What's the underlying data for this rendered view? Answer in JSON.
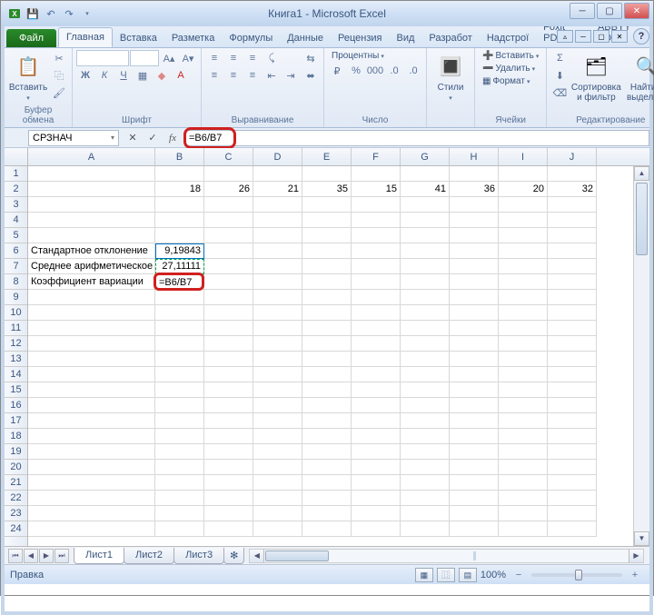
{
  "window": {
    "title": "Книга1 - Microsoft Excel"
  },
  "qat": {
    "save": "save-icon",
    "undo": "undo-icon",
    "redo": "redo-icon"
  },
  "tabs": {
    "file": "Файл",
    "items": [
      "Главная",
      "Вставка",
      "Разметка",
      "Формулы",
      "Данные",
      "Рецензия",
      "Вид",
      "Разработ",
      "Надстрої",
      "Foxit PDF",
      "ABBYY PD"
    ],
    "active_index": 0
  },
  "ribbon": {
    "clipboard": {
      "label": "Буфер обмена",
      "paste": "Вставить"
    },
    "font": {
      "label": "Шрифт",
      "family": "",
      "size": "",
      "bold": "Ж",
      "italic": "К",
      "underline": "Ч"
    },
    "alignment": {
      "label": "Выравнивание"
    },
    "number": {
      "label": "Число",
      "format": "Процентны"
    },
    "styles": {
      "label": "",
      "btn": "Стили"
    },
    "cells": {
      "label": "Ячейки",
      "insert": "Вставить",
      "delete": "Удалить",
      "format": "Формат"
    },
    "editing": {
      "label": "Редактирование",
      "sort": "Сортировка и фильтр",
      "find": "Найти и выделить"
    }
  },
  "formula_bar": {
    "name_box": "СРЗНАЧ",
    "formula": "=B6/B7"
  },
  "grid": {
    "columns": [
      "A",
      "B",
      "C",
      "D",
      "E",
      "F",
      "G",
      "H",
      "I",
      "J"
    ],
    "rows_visible": 24,
    "data": {
      "row2": [
        "",
        "18",
        "26",
        "21",
        "35",
        "15",
        "41",
        "36",
        "20",
        "32"
      ],
      "A6": "Стандартное отклонение",
      "B6": "9,19843",
      "A7": "Среднее арифметическое",
      "B7": "27,11111",
      "A8": "Коэффициент вариации",
      "B8_edit": "=B6/B7"
    }
  },
  "sheets": {
    "tabs": [
      "Лист1",
      "Лист2",
      "Лист3"
    ],
    "active_index": 0
  },
  "status": {
    "mode": "Правка",
    "zoom": "100%"
  }
}
